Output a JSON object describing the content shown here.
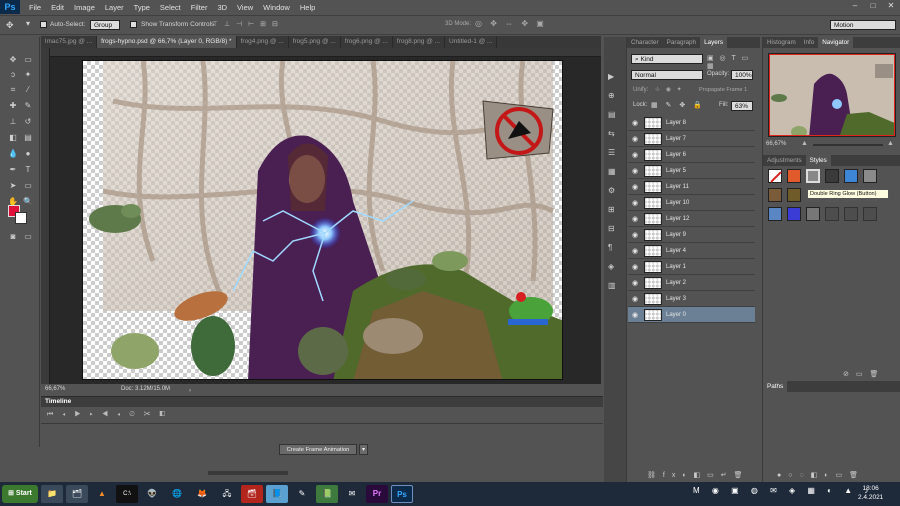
{
  "app": {
    "logo": "Ps"
  },
  "menu": [
    "File",
    "Edit",
    "Image",
    "Layer",
    "Type",
    "Select",
    "Filter",
    "3D",
    "View",
    "Window",
    "Help"
  ],
  "window_controls": [
    "–",
    "□",
    "✕"
  ],
  "options_bar": {
    "auto_select_label": "Auto-Select:",
    "auto_select_checked": true,
    "auto_select_value": "Group",
    "show_transform_label": "Show Transform Controls",
    "show_transform_checked": true,
    "mode_3d_label": "3D Mode:",
    "workspace": "Motion"
  },
  "doc_tabs": [
    {
      "label": "lmac75.jpg @ ...",
      "active": false
    },
    {
      "label": "frogs-hypno.psd @ 66,7% (Layer 0, RGB/8) *",
      "active": true
    },
    {
      "label": "frog4.png @ ...",
      "active": false
    },
    {
      "label": "frog5.png @ ...",
      "active": false
    },
    {
      "label": "frog6.png @ ...",
      "active": false
    },
    {
      "label": "frog8.png @ ...",
      "active": false
    },
    {
      "label": "Untitled-1 @ ...",
      "active": false
    }
  ],
  "status": {
    "zoom": "66,67%",
    "doc": "Doc: 3.12M/15.0M"
  },
  "timeline": {
    "title": "Timeline",
    "create_button": "Create Frame Animation"
  },
  "layers_panel": {
    "tabs": [
      "Character",
      "Paragraph",
      "Layers"
    ],
    "active_tab": "Layers",
    "filter_kind": "Kind",
    "blend_mode": "Normal",
    "opacity_label": "Opacity:",
    "opacity_value": "100%",
    "unify_label": "Unify:",
    "propagate_label": "Propagate Frame 1",
    "lock_label": "Lock:",
    "fill_label": "Fill:",
    "fill_value": "63%",
    "layers": [
      {
        "name": "Layer 8",
        "selected": false
      },
      {
        "name": "Layer 7",
        "selected": false
      },
      {
        "name": "Layer 6",
        "selected": false
      },
      {
        "name": "Layer 5",
        "selected": false
      },
      {
        "name": "Layer 11",
        "selected": false
      },
      {
        "name": "Layer 10",
        "selected": false
      },
      {
        "name": "Layer 12",
        "selected": false
      },
      {
        "name": "Layer 9",
        "selected": false
      },
      {
        "name": "Layer 4",
        "selected": false
      },
      {
        "name": "Layer 1",
        "selected": false
      },
      {
        "name": "Layer 2",
        "selected": false
      },
      {
        "name": "Layer 3",
        "selected": false
      },
      {
        "name": "Layer 0",
        "selected": true
      }
    ]
  },
  "navigator_panel": {
    "tabs": [
      "Histogram",
      "Info",
      "Navigator"
    ],
    "active_tab": "Navigator",
    "zoom": "66,67%"
  },
  "styles_panel": {
    "tabs": [
      "Adjustments",
      "Styles"
    ],
    "active_tab": "Styles",
    "tooltip": "Double Ring Glow (Button)"
  },
  "paths_panel": {
    "tabs": [
      "Paths"
    ]
  },
  "taskbar": {
    "start_label": "Start",
    "items": [
      "📁",
      "🗂",
      "▲",
      "C:\\",
      "👽",
      "🌐",
      "🦊",
      "🖧",
      "🗃",
      "📘",
      "✎",
      "📗",
      "✉",
      "Pr",
      "Ps"
    ],
    "clock_time": "18:06",
    "clock_date": "2.4.2021"
  },
  "colors": {
    "accent_layer_sel": "#6b7f95",
    "foreground": "#e0103a",
    "background": "#ffffff"
  }
}
